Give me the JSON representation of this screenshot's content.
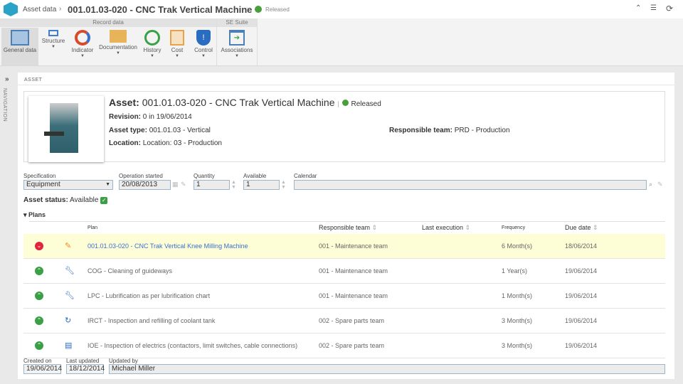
{
  "header": {
    "breadcrumb": "Asset data",
    "title": "001.01.03-020 - CNC Trak Vertical Machine",
    "status": "Released"
  },
  "ribbon": {
    "groups": [
      "Record data",
      "SE Suite"
    ],
    "buttons": [
      {
        "label": "General data",
        "icon": "window-icon"
      },
      {
        "label": "Structure",
        "icon": "structure-icon"
      },
      {
        "label": "Indicator",
        "icon": "gauge-icon"
      },
      {
        "label": "Documentation",
        "icon": "folder-clip-icon"
      },
      {
        "label": "History",
        "icon": "history-clock-icon"
      },
      {
        "label": "Cost",
        "icon": "cost-icon"
      },
      {
        "label": "Control",
        "icon": "shield-warning-icon"
      },
      {
        "label": "Associations",
        "icon": "associations-icon"
      }
    ]
  },
  "nav": {
    "label": "NAVIGATION"
  },
  "section": "ASSET",
  "asset": {
    "title_label": "Asset:",
    "title": "001.01.03-020 - CNC Trak Vertical Machine",
    "status": "Released",
    "revision_label": "Revision:",
    "revision": "0 in 19/06/2014",
    "type_label": "Asset type:",
    "type": "001.01.03 - Vertical",
    "team_label": "Responsible team:",
    "team": "PRD - Production",
    "location_label": "Location:",
    "location": "Location: 03 - Production"
  },
  "fields": {
    "specification_label": "Specification",
    "specification": "Equipment",
    "operation_label": "Operation started",
    "operation": "20/08/2013",
    "quantity_label": "Quantity",
    "quantity": "1",
    "available_label": "Available",
    "available": "1",
    "calendar_label": "Calendar",
    "calendar": ""
  },
  "asset_status": {
    "label": "Asset status:",
    "value": "Available"
  },
  "plans": {
    "title": "Plans",
    "columns": [
      "Plan",
      "Responsible team",
      "Last execution",
      "Frequency",
      "Due date"
    ],
    "rows": [
      {
        "status": "overdue",
        "icon": "tool-orange-icon",
        "plan": "001.01.03-020 - CNC Trak Vertical Knee Milling Machine",
        "team": "001 - Maintenance team",
        "last": "",
        "frequency": "6 Month(s)",
        "due": "18/06/2014"
      },
      {
        "status": "ok",
        "icon": "wrench-icon",
        "plan": "COG - Cleaning of guideways",
        "team": "001 - Maintenance team",
        "last": "",
        "frequency": "1 Year(s)",
        "due": "19/06/2014"
      },
      {
        "status": "ok",
        "icon": "wrench-icon",
        "plan": "LPC - Lubrification as per lubrification chart",
        "team": "001 - Maintenance team",
        "last": "",
        "frequency": "1 Month(s)",
        "due": "19/06/2014"
      },
      {
        "status": "ok",
        "icon": "refill-icon",
        "plan": "IRCT - Inspection and refilling of coolant tank",
        "team": "002 - Spare parts team",
        "last": "",
        "frequency": "3 Month(s)",
        "due": "19/06/2014"
      },
      {
        "status": "ok",
        "icon": "clipboard-icon",
        "plan": "IOE - Inspection of electrics (contactors, limit switches, cable connections)",
        "team": "002 - Spare parts team",
        "last": "",
        "frequency": "3 Month(s)",
        "due": "19/06/2014"
      }
    ]
  },
  "footer": {
    "created_label": "Created on",
    "created": "19/06/2014",
    "updated_label": "Last updated",
    "updated": "18/12/2014",
    "by_label": "Updated by",
    "by": "Michael Miller"
  },
  "colors": {
    "accent": "#2ba3c6",
    "link": "#3a6fd1",
    "ok": "#3aa046",
    "overdue": "#e0263c",
    "highlight": "#fdfdd6"
  }
}
